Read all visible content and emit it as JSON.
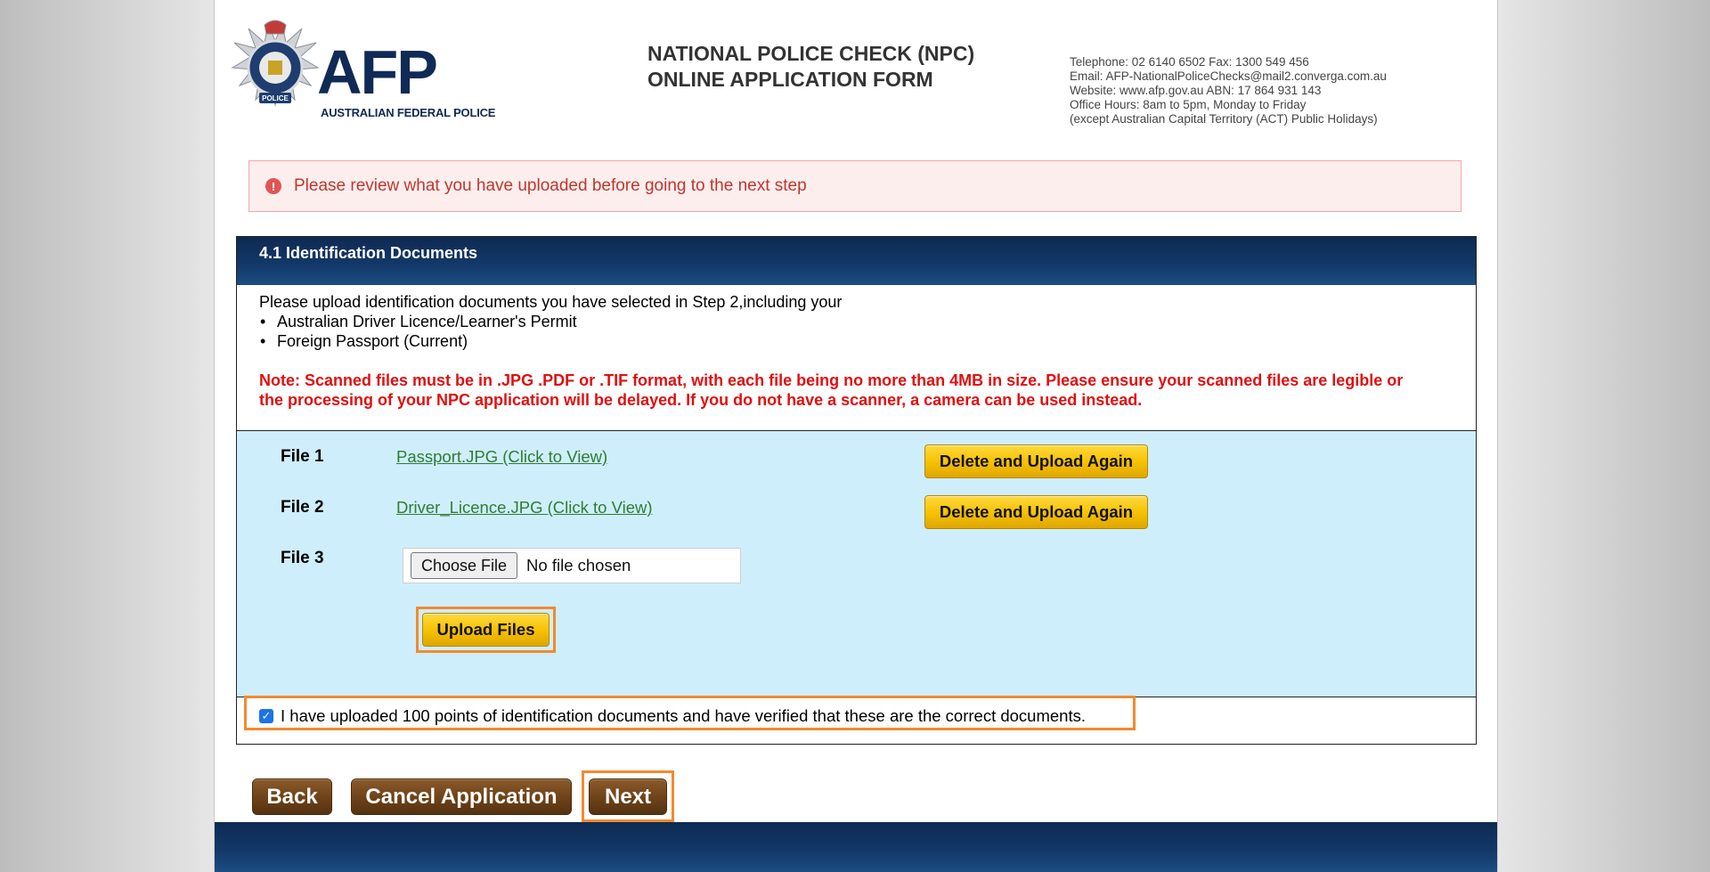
{
  "header": {
    "logo_text": "AFP",
    "logo_subtitle": "AUSTRALIAN FEDERAL POLICE",
    "badge_text": "POLICE",
    "badge_ring_text": "AUSTRALIAN FEDERAL",
    "title_line1": "NATIONAL POLICE CHECK (NPC)",
    "title_line2": "ONLINE APPLICATION FORM",
    "contact": [
      "Telephone: 02 6140 6502  Fax: 1300 549 456",
      "Email: AFP-NationalPoliceChecks@mail2.converga.com.au",
      "Website: www.afp.gov.au    ABN: 17 864 931 143",
      "Office Hours: 8am to 5pm, Monday to Friday",
      "(except Australian Capital Territory (ACT) Public Holidays)"
    ]
  },
  "alert": {
    "icon": "exclamation-icon",
    "text": "Please review what you have uploaded before going to the next step"
  },
  "panel": {
    "title": "4.1 Identification Documents",
    "intro": "Please upload identification documents you have selected in Step 2,including your",
    "documents": [
      "Australian Driver Licence/Learner's Permit",
      "Foreign Passport (Current)"
    ],
    "note": "Note: Scanned files must be in .JPG .PDF or .TIF format, with each file being no more than 4MB in size. Please ensure your scanned files are legible or the processing of your NPC application will be delayed. If you do not have a scanner, a camera can be used instead."
  },
  "files": [
    {
      "label": "File 1",
      "link": "Passport.JPG (Click to View)",
      "action": "Delete and Upload Again"
    },
    {
      "label": "File 2",
      "link": "Driver_Licence.JPG (Click to View)",
      "action": "Delete and Upload Again"
    },
    {
      "label": "File 3",
      "choose_label": "Choose File",
      "status": "No file chosen"
    }
  ],
  "upload_label": "Upload Files",
  "confirm": {
    "checked": true,
    "text": "I have uploaded 100 points of identification documents and have verified that these are the correct documents."
  },
  "nav": {
    "back": "Back",
    "cancel": "Cancel Application",
    "next": "Next"
  },
  "colors": {
    "header_blue": "#13396a",
    "alert_text": "#c0362c",
    "note_red": "#e01010",
    "file_area": "#cfeefb",
    "gold_button": "#f5c000",
    "brown_button": "#6d4218",
    "highlight": "#f28a2e"
  }
}
